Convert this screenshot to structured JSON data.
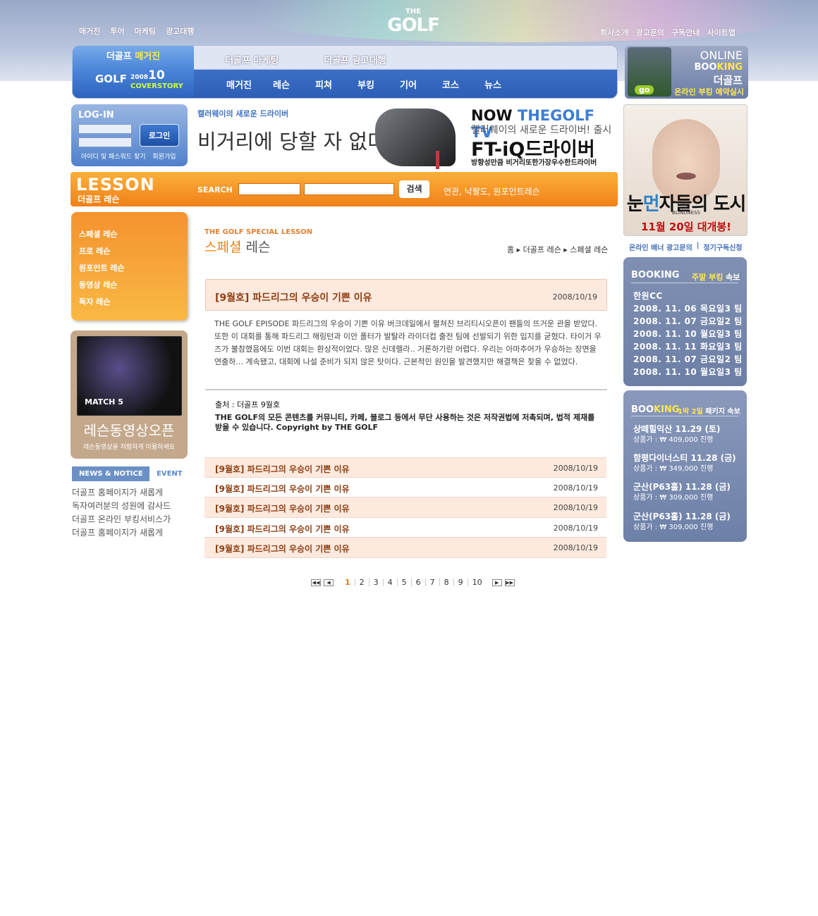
{
  "header": {
    "logo_small": "THE",
    "logo_big": "GOLF",
    "top_left_links": [
      "매거진",
      "투어",
      "마케팅",
      "광고대행"
    ],
    "top_right_links": [
      "회사소개",
      "광고문의",
      "구독안내",
      "사이트맵"
    ]
  },
  "nav": {
    "tab_label_prefix": "더골프",
    "tab_label_suffix": "매거진",
    "tab_logo": "GOLF",
    "tab_cover_year": "2008",
    "tab_cover_month": "10",
    "tab_cover_label": "COVERSTORY",
    "upper_links": [
      "더골프 마케팅",
      "더골프 광고대행"
    ],
    "lower_links": [
      "매거진",
      "레슨",
      "피쳐",
      "부킹",
      "기어",
      "코스",
      "뉴스"
    ]
  },
  "booking_ad": {
    "line1": "ONLINE",
    "line2_a": "BOO",
    "line2_b": "KING",
    "line3": "더골프",
    "line4": "온라인 부킹 예약실시",
    "go": "go"
  },
  "login": {
    "title": "LOG-IN",
    "button": "로그인",
    "find_link": "아이디 및 패스워드 찾기",
    "join_link": "회원가입"
  },
  "banner": {
    "subtitle": "캘러웨이의 새로운 드라이버",
    "main": "비거리에 당할 자 없다!",
    "tv_a": "NOW ",
    "tv_b": "THEGOLF TV",
    "tv_line2": "캘러웨이의 새로운 드라이버! 출시",
    "tv_line3": "FT-iQ드라이버",
    "tv_line4": "방향성만큼 비거리또한가장우수한드라이버"
  },
  "movie": {
    "title_a": "눈",
    "title_b": "먼",
    "title_c": "자들의 도시",
    "subtitle": "BLINDNESS",
    "date": "11월 20일 대개봉!"
  },
  "banner_links": [
    "온라인 배너 광고문의",
    "|",
    "정기구독신청"
  ],
  "lesson_bar": {
    "title_en": "LESSON",
    "title_ko": "더골프 레슨",
    "search_label": "SEARCH",
    "search_button": "검색",
    "keywords": "연관, 낙팔도, 원포인트레슨"
  },
  "left_menu": [
    "스페셜 레슨",
    "프로 레슨",
    "원포인트 레슨",
    "동영상 레슨",
    "독자 레슨"
  ],
  "video_box": {
    "caption": "MATCH 5",
    "title": "레슨동영상오픈",
    "subtitle": "레슨동영상을 저렴하게 이용하세요"
  },
  "news": {
    "tab_active": "NEWS & NOTICE",
    "tab_inactive": "EVENT",
    "items": [
      "더골프 홈페이지가 새롭게",
      "독자여러분의 성원에 감사드",
      "더골프 온라인 부킹서비스가",
      "더골프 홈페이지가 새롭게"
    ]
  },
  "content": {
    "header_en": "THE GOLF SPECIAL LESSON",
    "header_ko_a": "스페셜",
    "header_ko_b": " 레슨",
    "breadcrumb": "홈 ▸ 더골프 레슨 ▸ 스페셜 레슨",
    "article_title": "[9월호] 파드리그의 우승이 기쁜 이유",
    "article_date": "2008/10/19",
    "body": "THE GOLF EPISODE 파드리그의 우승이 기쁜 이유 버크데일에서 펼쳐진 브리티시오픈이 팬들의 뜨거운 관을 받았다. 또한 이 대회를 통해 파드리그 해링턴과 이안 폴터가 발탈라 라이더컵 출전 팀에 선발되기 위한 입지를 굳혔다. 타이거 우즈가 불참했음에도 이번 대회는 환상적이었다. 많은 신데렐라.. 거론하기란 어렵다. 우리는 아마추어가 우승하는 장면을 연출하... 계속됐고, 대회에 나설 준비가 되지 않은 탓이다. 근본적인 원인을 발견했지만 해결책은 찾을 수 없었다.",
    "source": "출처 : 더골프 9월호",
    "copyright": "THE GOLF의 모든 콘텐츠를 커뮤니티, 카페, 블로그 등에서 무단 사용하는 것은 저작권법에 저촉되며, 법적 제재를 받을 수 있습니다. Copyright by THE GOLF",
    "list": [
      {
        "title": "[9월호] 파드리그의 우승이 기쁜 이유",
        "date": "2008/10/19"
      },
      {
        "title": "[9월호] 파드리그의 우승이 기쁜 이유",
        "date": "2008/10/19"
      },
      {
        "title": "[9월호] 파드리그의 우승이 기쁜 이유",
        "date": "2008/10/19"
      },
      {
        "title": "[9월호] 파드리그의 우승이 기쁜 이유",
        "date": "2008/10/19"
      },
      {
        "title": "[9월호] 파드리그의 우승이 기쁜 이유",
        "date": "2008/10/19"
      }
    ],
    "pages": [
      "1",
      "2",
      "3",
      "4",
      "5",
      "6",
      "7",
      "8",
      "9",
      "10"
    ],
    "current_page": "1"
  },
  "weekend_booking": {
    "title": "BOOKING",
    "label_a": "주말 부킹",
    "label_b": " 속보",
    "items": [
      "한원CC",
      "2008. 11. 06 목요일3 팀",
      "2008. 11. 07 금요일2 팀",
      "2008. 11. 10 월요일3 팀",
      "2008. 11. 11 화요일3 팀",
      "2008. 11. 07 금요일2 팀",
      "2008. 11. 10 월요일3 팀"
    ]
  },
  "package_booking": {
    "title_a": "BOO",
    "title_b": "KING",
    "label_a": "1박 2일",
    "label_b": " 패키지 속보",
    "items": [
      {
        "name": "상떼힐익산 11.29 (토)",
        "price": "상품가 : ₩ 409,000 진행"
      },
      {
        "name": "함평다이너스티 11.28 (금)",
        "price": "상품가 : ₩ 349,000 진행"
      },
      {
        "name": "군산(P63홀) 11.28 (금)",
        "price": "상품가 : ₩ 309,000 진행"
      },
      {
        "name": "군산(P63홀) 11.28 (금)",
        "price": "상품가 : ₩ 309,000 진행"
      }
    ]
  }
}
